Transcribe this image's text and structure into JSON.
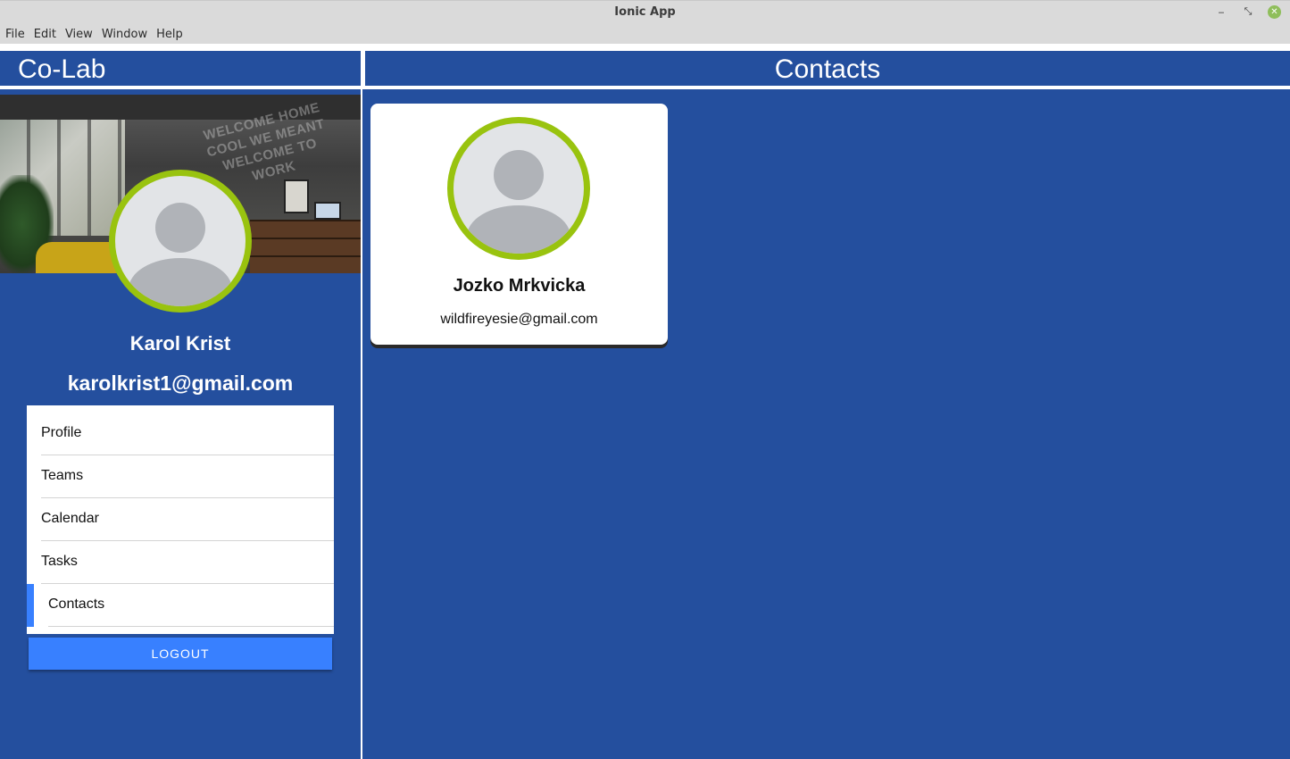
{
  "window": {
    "title": "Ionic App",
    "minimize_glyph": "‒",
    "maximize_glyph": "⤡",
    "close_glyph": "✕"
  },
  "menubar": {
    "items": [
      "File",
      "Edit",
      "View",
      "Window",
      "Help"
    ]
  },
  "app": {
    "brand": "Co-Lab",
    "cover_neon_text": "WELCOME HOME\nCOOL WE MEANT\nWELCOME TO WORK"
  },
  "user": {
    "name": "Karol Krist",
    "email": "karolkrist1@gmail.com",
    "avatar_icon": "person-placeholder-icon"
  },
  "sidebar": {
    "items": [
      {
        "label": "Profile",
        "active": false
      },
      {
        "label": "Teams",
        "active": false
      },
      {
        "label": "Calendar",
        "active": false
      },
      {
        "label": "Tasks",
        "active": false
      },
      {
        "label": "Contacts",
        "active": true
      }
    ],
    "logout_label": "LOGOUT"
  },
  "page": {
    "title": "Contacts"
  },
  "contacts": [
    {
      "name": "Jozko Mrkvicka",
      "email": "wildfireyesie@gmail.com",
      "avatar_icon": "person-placeholder-icon"
    }
  ],
  "colors": {
    "primary_blue": "#244f9e",
    "accent_button": "#3880ff",
    "avatar_ring": "#99c30f",
    "close_button": "#8fbe5b"
  }
}
